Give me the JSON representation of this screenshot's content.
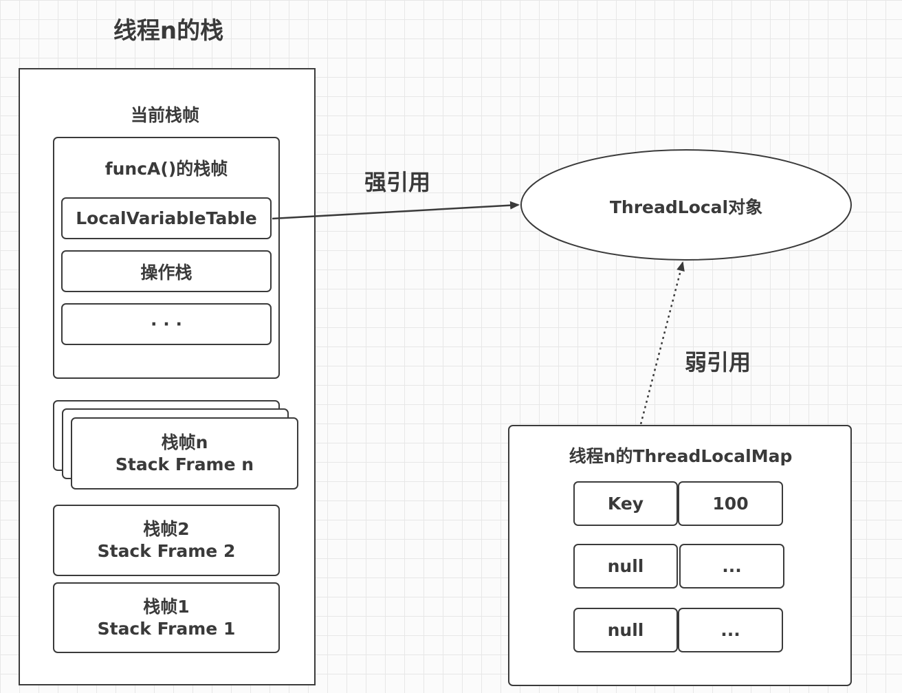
{
  "stack": {
    "title": "线程n的栈",
    "current_frame_label": "当前栈帧",
    "funcA_label": "funcA()的栈帧",
    "local_variable_table": "LocalVariableTable",
    "operand_stack": "操作栈",
    "ellipsis": "·  ·  ·",
    "frame_n": {
      "line1": "栈帧n",
      "line2": "Stack Frame n"
    },
    "frame_2": {
      "line1": "栈帧2",
      "line2": "Stack Frame 2"
    },
    "frame_1": {
      "line1": "栈帧1",
      "line2": "Stack Frame 1"
    }
  },
  "threadlocal": {
    "label": "ThreadLocal对象"
  },
  "edges": {
    "strong_ref": "强引用",
    "weak_ref": "弱引用"
  },
  "map": {
    "title": "线程n的ThreadLocalMap",
    "rows": [
      {
        "key": "Key",
        "value": "100"
      },
      {
        "key": "null",
        "value": "..."
      },
      {
        "key": "null",
        "value": "..."
      }
    ]
  },
  "colors": {
    "stroke": "#3a3a3a",
    "grid": "#e7e7e7",
    "background": "#fbfbfb"
  }
}
